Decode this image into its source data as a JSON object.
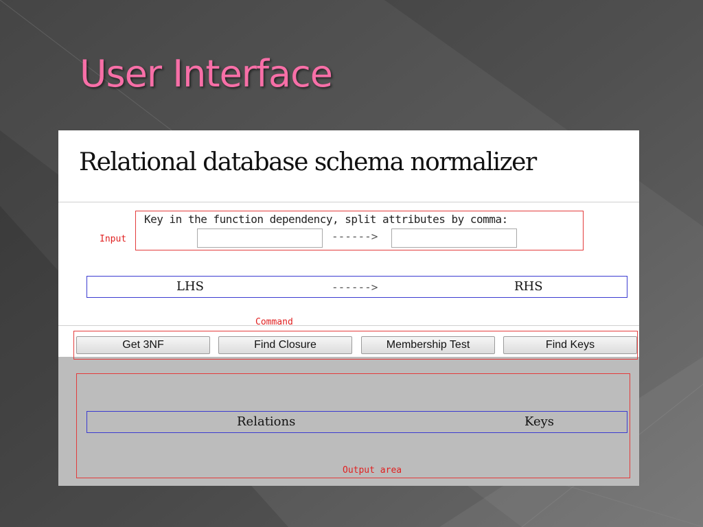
{
  "slide": {
    "title": "User Interface"
  },
  "app": {
    "title": "Relational database schema normalizer",
    "input_section": {
      "annotation": "Input",
      "prompt": "Key in the function dependency, split attributes by comma:",
      "arrow": "------>",
      "lhs_value": "",
      "rhs_value": ""
    },
    "dependency_table": {
      "lhs_header": "LHS",
      "arrow": "------>",
      "rhs_header": "RHS"
    },
    "command_section": {
      "annotation": "Command",
      "buttons": [
        {
          "label": "Get 3NF"
        },
        {
          "label": "Find Closure"
        },
        {
          "label": "Membership Test"
        },
        {
          "label": "Find Keys"
        }
      ]
    },
    "output_section": {
      "annotation": "Output area",
      "relations_header": "Relations",
      "keys_header": "Keys"
    }
  },
  "colors": {
    "title_pink": "#f76fa7",
    "annotation_red": "#e02020",
    "table_blue": "#3a3ad0",
    "output_gray": "#bcbcbc"
  }
}
